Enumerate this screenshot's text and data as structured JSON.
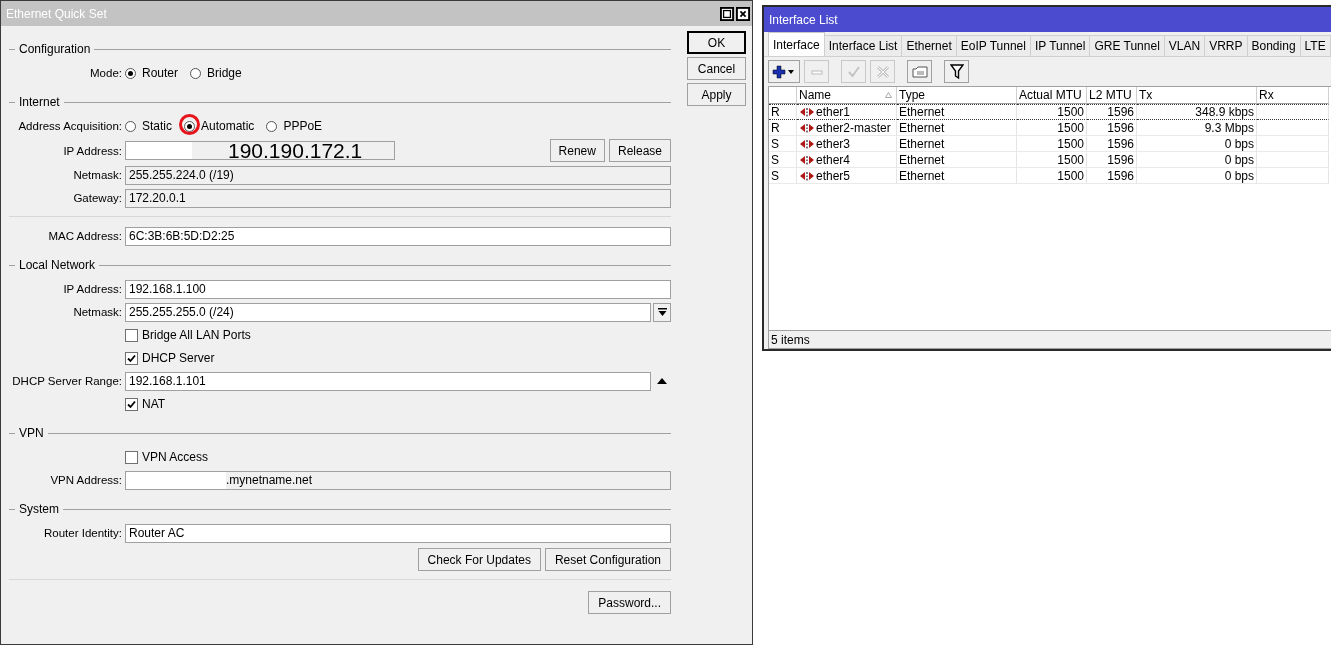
{
  "quick_set": {
    "title": "Ethernet Quick Set",
    "active": false,
    "sections": [
      {
        "title": "Configuration",
        "rows": [
          {
            "kind": "radio",
            "label": "Mode:",
            "options": [
              {
                "label": "Router",
                "selected": true,
                "highlighted": false
              },
              {
                "label": "Bridge",
                "selected": false,
                "highlighted": false
              }
            ]
          }
        ]
      },
      {
        "title": "Internet",
        "rows": [
          {
            "kind": "radio",
            "label": "Address Acquisition:",
            "options": [
              {
                "label": "Static",
                "selected": false,
                "highlighted": false
              },
              {
                "label": "Automatic",
                "selected": true,
                "highlighted": true
              },
              {
                "label": "PPPoE",
                "selected": false,
                "highlighted": false
              }
            ]
          },
          {
            "kind": "field",
            "label": "IP Address:",
            "value": "190.190.172.1",
            "readonly": true,
            "redacted": true,
            "enlarged": true,
            "buttons": [
              "Renew",
              "Release"
            ]
          },
          {
            "kind": "field",
            "label": "Netmask:",
            "value": "255.255.224.0 (/19)",
            "readonly": true,
            "redacted": false
          },
          {
            "kind": "field",
            "label": "Gateway:",
            "value": "172.20.0.1",
            "readonly": true,
            "redacted": false
          },
          {
            "kind": "separator"
          },
          {
            "kind": "field",
            "label": "MAC Address:",
            "value": "6C:3B:6B:5D:D2:25",
            "readonly": false,
            "redacted": false
          }
        ]
      },
      {
        "title": "Local Network",
        "rows": [
          {
            "kind": "field",
            "label": "IP Address:",
            "value": "192.168.1.100",
            "readonly": false,
            "redacted": false
          },
          {
            "kind": "field",
            "label": "Netmask:",
            "value": "255.255.255.0 (/24)",
            "readonly": false,
            "redacted": false,
            "dropdown_button": true
          },
          {
            "kind": "checkbox",
            "label": "Bridge All LAN Ports",
            "checked": false
          },
          {
            "kind": "checkbox",
            "label": "DHCP Server",
            "checked": true
          },
          {
            "kind": "field",
            "label": "DHCP Server Range:",
            "value": "192.168.1.101",
            "readonly": false,
            "redacted": false,
            "collapse_arrow": true
          },
          {
            "kind": "checkbox",
            "label": "NAT",
            "checked": true
          }
        ]
      },
      {
        "title": "VPN",
        "rows": [
          {
            "kind": "checkbox",
            "label": "VPN Access",
            "checked": false
          },
          {
            "kind": "field",
            "label": "VPN Address:",
            "value": ".mynetname.net",
            "readonly": true,
            "redacted": true
          }
        ]
      },
      {
        "title": "System",
        "rows": [
          {
            "kind": "field",
            "label": "Router Identity:",
            "value": "Router AC",
            "readonly": false,
            "redacted": false
          },
          {
            "kind": "buttons",
            "buttons": [
              "Check For Updates",
              "Reset Configuration"
            ]
          },
          {
            "kind": "separator"
          },
          {
            "kind": "buttons",
            "buttons": [
              "Password..."
            ]
          }
        ]
      }
    ],
    "actions": [
      {
        "label": "OK",
        "default": true
      },
      {
        "label": "Cancel",
        "default": false
      },
      {
        "label": "Apply",
        "default": false
      }
    ]
  },
  "interface_list": {
    "title": "Interface List",
    "active": true,
    "tabs": [
      {
        "label": "Interface",
        "selected": true
      },
      {
        "label": "Interface List",
        "selected": false
      },
      {
        "label": "Ethernet",
        "selected": false
      },
      {
        "label": "EoIP Tunnel",
        "selected": false
      },
      {
        "label": "IP Tunnel",
        "selected": false
      },
      {
        "label": "GRE Tunnel",
        "selected": false
      },
      {
        "label": "VLAN",
        "selected": false
      },
      {
        "label": "VRRP",
        "selected": false
      },
      {
        "label": "Bonding",
        "selected": false
      },
      {
        "label": "LTE",
        "selected": false
      }
    ],
    "toolbar": [
      {
        "kind": "add",
        "disabled": false
      },
      {
        "kind": "remove",
        "disabled": true
      },
      {
        "kind": "enable",
        "disabled": true
      },
      {
        "kind": "disable",
        "disabled": true
      },
      {
        "kind": "comment",
        "disabled": false
      },
      {
        "kind": "filter",
        "disabled": false
      }
    ],
    "columns": [
      {
        "label": "Name",
        "sorted": true
      },
      {
        "label": "Type",
        "sorted": false
      },
      {
        "label": "Actual MTU",
        "sorted": false
      },
      {
        "label": "L2 MTU",
        "sorted": false
      },
      {
        "label": "Tx",
        "sorted": false
      },
      {
        "label": "Rx",
        "sorted": false
      }
    ],
    "rows": [
      {
        "flag": "R",
        "name": "ether1",
        "type": "Ethernet",
        "actual_mtu": "1500",
        "l2_mtu": "1596",
        "tx": "348.9 kbps",
        "focused": true
      },
      {
        "flag": "R",
        "name": "ether2-master",
        "type": "Ethernet",
        "actual_mtu": "1500",
        "l2_mtu": "1596",
        "tx": "9.3 Mbps",
        "focused": false
      },
      {
        "flag": "S",
        "name": "ether3",
        "type": "Ethernet",
        "actual_mtu": "1500",
        "l2_mtu": "1596",
        "tx": "0 bps",
        "focused": false
      },
      {
        "flag": "S",
        "name": "ether4",
        "type": "Ethernet",
        "actual_mtu": "1500",
        "l2_mtu": "1596",
        "tx": "0 bps",
        "focused": false
      },
      {
        "flag": "S",
        "name": "ether5",
        "type": "Ethernet",
        "actual_mtu": "1500",
        "l2_mtu": "1596",
        "tx": "0 bps",
        "focused": false
      }
    ],
    "status": "5 items"
  }
}
